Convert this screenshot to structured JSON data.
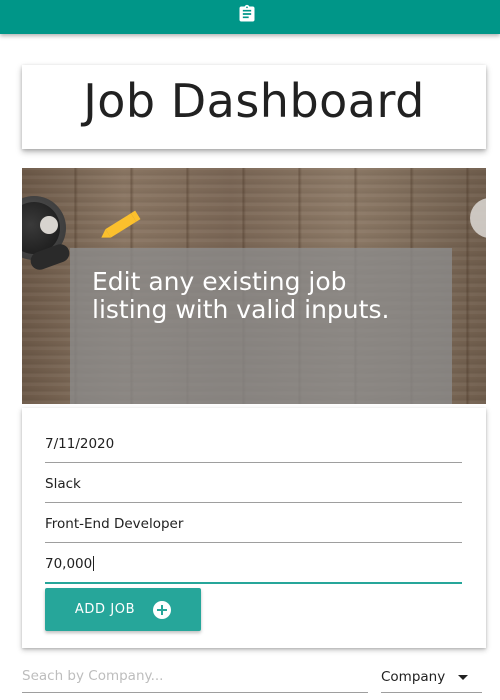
{
  "header": {
    "icon": "clipboard-icon",
    "bar_color": "#009688"
  },
  "page": {
    "title": "Job Dashboard"
  },
  "hero": {
    "icon": "pencil-icon",
    "message": "Edit any existing job listing with valid inputs."
  },
  "form": {
    "date": "7/11/2020",
    "company": "Slack",
    "position": "Front-End Developer",
    "salary": "70,000",
    "add_button_label": "ADD JOB",
    "add_button_icon": "add-circle-icon",
    "accent_color": "#26a69a"
  },
  "filters": {
    "search_placeholder": "Seach by Company...",
    "sort_selected": "Company",
    "sort_icon": "chevron-down-icon"
  }
}
